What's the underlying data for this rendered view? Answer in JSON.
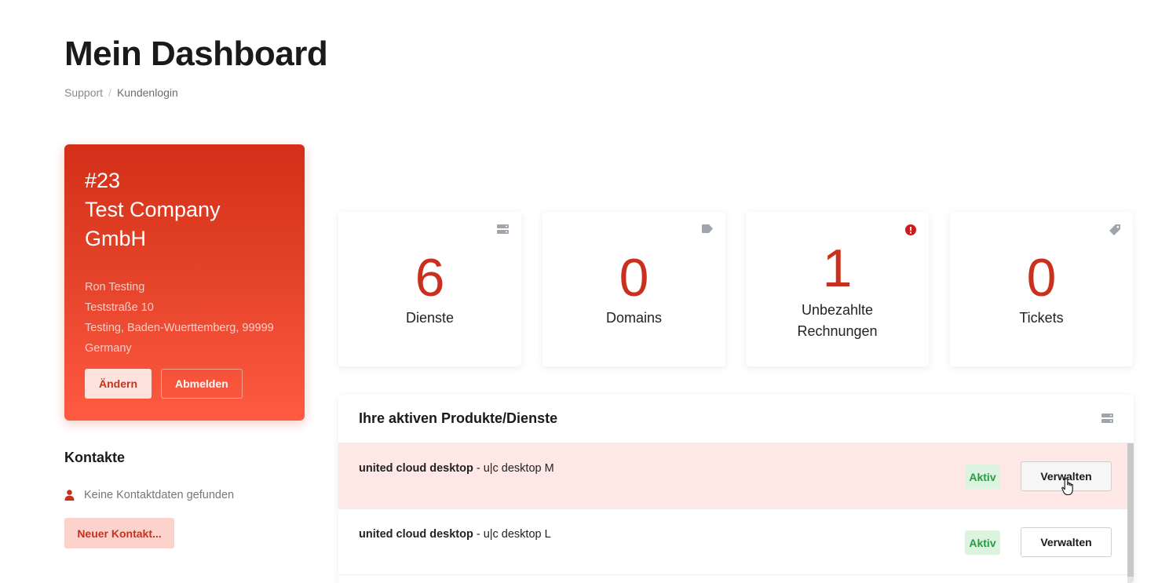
{
  "page": {
    "title": "Mein Dashboard",
    "breadcrumb": [
      {
        "label": "Support"
      },
      {
        "label": "Kundenlogin"
      }
    ]
  },
  "client": {
    "number": "#23",
    "company": "Test Company GmbH",
    "name": "Ron Testing",
    "street": "Teststraße 10",
    "city_line": "Testing, Baden-Wuerttemberg, 99999",
    "country": "Germany",
    "edit_label": "Ändern",
    "logout_label": "Abmelden"
  },
  "contacts": {
    "title": "Kontakte",
    "empty_text": "Keine Kontaktdaten gefunden",
    "new_contact_label": "Neuer Kontakt..."
  },
  "stats": [
    {
      "value": "6",
      "label": "Dienste",
      "icon": "server-icon"
    },
    {
      "value": "0",
      "label": "Domains",
      "icon": "tag-icon"
    },
    {
      "value": "1",
      "label": "Unbezahlte Rechnungen",
      "icon": "alert-circle-icon"
    },
    {
      "value": "0",
      "label": "Tickets",
      "icon": "ticket-tag-icon"
    }
  ],
  "products": {
    "title": "Ihre aktiven Produkte/Dienste",
    "icon": "server-icon",
    "rows": [
      {
        "product": "united cloud desktop",
        "variant": " - u|c desktop M",
        "status": "Aktiv",
        "action": "Verwalten"
      },
      {
        "product": "united cloud desktop",
        "variant": " - u|c desktop L",
        "status": "Aktiv",
        "action": "Verwalten"
      }
    ]
  },
  "colors": {
    "accent": "#c9301d",
    "card_gradient_top": "#d42f18",
    "card_gradient_bottom": "#ff5a42",
    "status_green": "#2a9a44",
    "row_highlight": "#fde8e6"
  }
}
